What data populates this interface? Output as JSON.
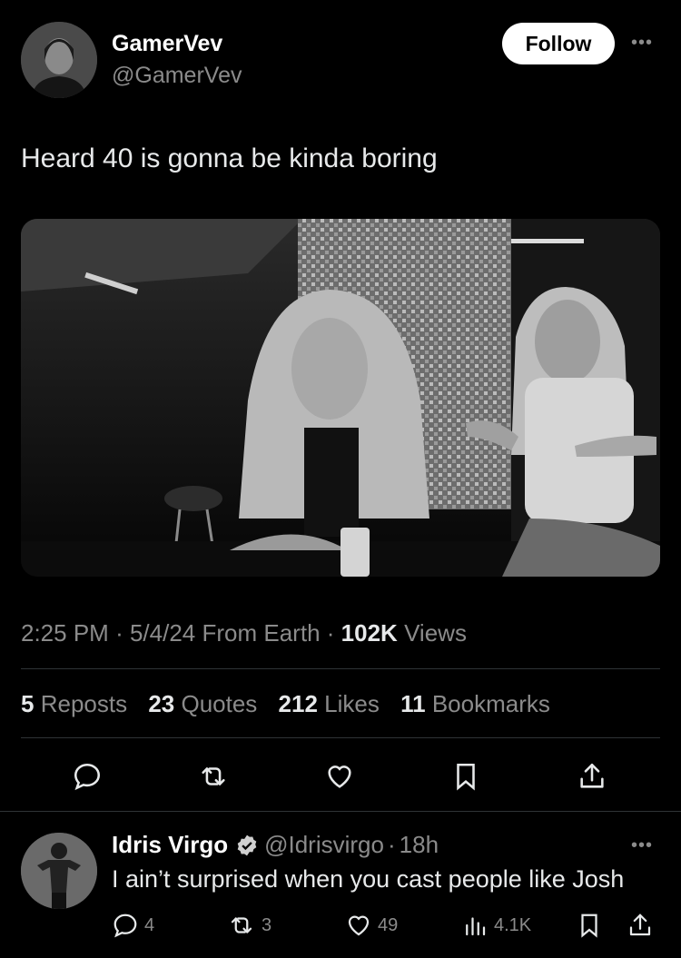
{
  "post": {
    "author_name": "GamerVev",
    "author_handle": "@GamerVev",
    "follow_label": "Follow",
    "more_label": "•••",
    "text": "Heard 40 is gonna be kinda boring",
    "time": "2:25 PM",
    "date": "5/4/24",
    "source": "From Earth",
    "views_count": "102K",
    "views_label": "Views",
    "sep": "·"
  },
  "stats": {
    "reposts_count": "5",
    "reposts_label": "Reposts",
    "quotes_count": "23",
    "quotes_label": "Quotes",
    "likes_count": "212",
    "likes_label": "Likes",
    "bookmarks_count": "11",
    "bookmarks_label": "Bookmarks"
  },
  "actions": [
    "reply-icon",
    "repost-icon",
    "like-icon",
    "bookmark-icon",
    "share-icon"
  ],
  "reply": {
    "author_name": "Idris Virgo",
    "author_handle": "@Idrisvirgo",
    "time": "18h",
    "sep": "·",
    "more_label": "•••",
    "text": "I ain’t surprised when you cast people like Josh",
    "replies": "4",
    "reposts": "3",
    "likes": "49",
    "views": "4.1K"
  }
}
